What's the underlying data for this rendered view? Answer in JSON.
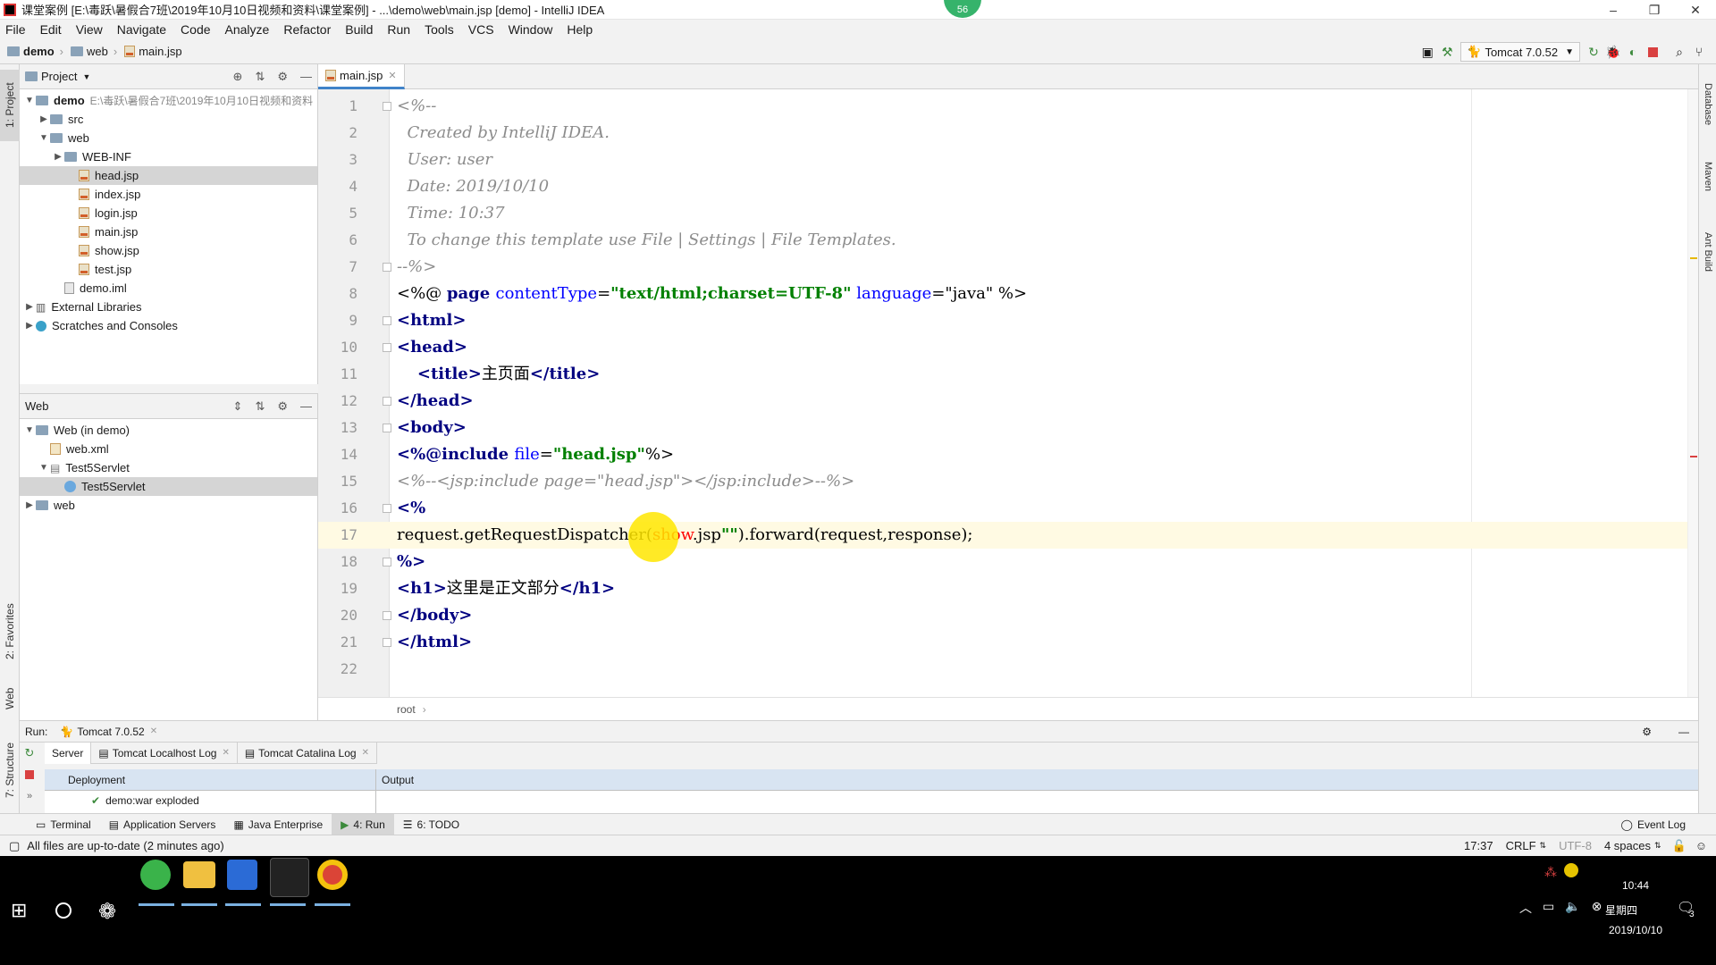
{
  "window": {
    "title": "课堂案例 [E:\\毒跃\\暑假合7班\\2019年10月10日视频和资料\\课堂案例] - ...\\demo\\web\\main.jsp [demo] - IntelliJ IDEA",
    "notification_badge": "56"
  },
  "menu": [
    "File",
    "Edit",
    "View",
    "Navigate",
    "Code",
    "Analyze",
    "Refactor",
    "Build",
    "Run",
    "Tools",
    "VCS",
    "Window",
    "Help"
  ],
  "nav": {
    "crumbs": [
      "demo",
      "web",
      "main.jsp"
    ],
    "run_config": "Tomcat 7.0.52"
  },
  "left_strip": {
    "project_tab": "1: Project",
    "favorites_tab": "2: Favorites",
    "web_tab": "Web",
    "structure_tab": "7: Structure"
  },
  "right_strip": [
    "Database",
    "Maven",
    "Ant Build"
  ],
  "project_panel": {
    "title": "Project",
    "tree": [
      {
        "label": "demo",
        "path": "E:\\毒跃\\暑假合7班\\2019年10月10日视频和资料",
        "indent": 0,
        "arrow": "down",
        "type": "module",
        "bold": true
      },
      {
        "label": "src",
        "indent": 1,
        "arrow": "right",
        "type": "folder"
      },
      {
        "label": "web",
        "indent": 1,
        "arrow": "down",
        "type": "folder"
      },
      {
        "label": "WEB-INF",
        "indent": 2,
        "arrow": "right",
        "type": "folder"
      },
      {
        "label": "head.jsp",
        "indent": 3,
        "arrow": "",
        "type": "jsp",
        "selected": true
      },
      {
        "label": "index.jsp",
        "indent": 3,
        "arrow": "",
        "type": "jsp"
      },
      {
        "label": "login.jsp",
        "indent": 3,
        "arrow": "",
        "type": "jsp"
      },
      {
        "label": "main.jsp",
        "indent": 3,
        "arrow": "",
        "type": "jsp"
      },
      {
        "label": "show.jsp",
        "indent": 3,
        "arrow": "",
        "type": "jsp"
      },
      {
        "label": "test.jsp",
        "indent": 3,
        "arrow": "",
        "type": "jsp"
      },
      {
        "label": "demo.iml",
        "indent": 2,
        "arrow": "",
        "type": "file"
      },
      {
        "label": "External Libraries",
        "indent": 0,
        "arrow": "right",
        "type": "lib"
      },
      {
        "label": "Scratches and Consoles",
        "indent": 0,
        "arrow": "right",
        "type": "scratch"
      }
    ]
  },
  "web_panel": {
    "title": "Web",
    "tree": [
      {
        "label": "Web (in demo)",
        "indent": 0,
        "arrow": "down",
        "type": "module"
      },
      {
        "label": "web.xml",
        "indent": 1,
        "arrow": "",
        "type": "xml"
      },
      {
        "label": "Test5Servlet",
        "indent": 1,
        "arrow": "down",
        "type": "servlet"
      },
      {
        "label": "Test5Servlet",
        "indent": 2,
        "arrow": "",
        "type": "class",
        "selected": true
      },
      {
        "label": "web",
        "indent": 0,
        "arrow": "right",
        "type": "folder"
      }
    ]
  },
  "editor": {
    "tab": "main.jsp",
    "breadcrumb": "root",
    "current_line": 17,
    "lines": [
      [
        [
          "cmt",
          "<%--"
        ]
      ],
      [
        [
          "cmt",
          "  Created by IntelliJ IDEA."
        ]
      ],
      [
        [
          "cmt",
          "  User: user"
        ]
      ],
      [
        [
          "cmt",
          "  Date: 2019/10/10"
        ]
      ],
      [
        [
          "cmt",
          "  Time: 10:37"
        ]
      ],
      [
        [
          "cmt",
          "  To change this template use File | Settings | File Templates."
        ]
      ],
      [
        [
          "cmt",
          "--%>"
        ]
      ],
      [
        [
          "plain",
          "<%@ "
        ],
        [
          "dir",
          "page "
        ],
        [
          "attr",
          "contentType"
        ],
        [
          "plain",
          "="
        ],
        [
          "str",
          "\"text/html;charset=UTF-8\""
        ],
        [
          "plain",
          " "
        ],
        [
          "attr",
          "language"
        ],
        [
          "plain",
          "=\""
        ],
        [
          "plain",
          "java"
        ],
        [
          "plain",
          "\" %>"
        ]
      ],
      [
        [
          "tag",
          "<html>"
        ]
      ],
      [
        [
          "tag",
          "<head>"
        ]
      ],
      [
        [
          "plain",
          "    "
        ],
        [
          "tag",
          "<title>"
        ],
        [
          "plain",
          "主页面"
        ],
        [
          "tag",
          "</title>"
        ]
      ],
      [
        [
          "tag",
          "</head>"
        ]
      ],
      [
        [
          "tag",
          "<body>"
        ]
      ],
      [
        [
          "dir",
          "<%@include "
        ],
        [
          "attr",
          "file"
        ],
        [
          "plain",
          "="
        ],
        [
          "str",
          "\"head.jsp\""
        ],
        [
          "plain",
          "%>"
        ]
      ],
      [
        [
          "cmt",
          "<%--<jsp:include page=\"head.jsp\"></jsp:include>--%>"
        ]
      ],
      [
        [
          "dir",
          "<%"
        ]
      ],
      [
        [
          "plain",
          "request.getRequestDispatcher("
        ],
        [
          "err",
          "show"
        ],
        [
          "plain",
          ".jsp"
        ],
        [
          "str",
          "\"\""
        ],
        [
          "plain",
          ").forward(request,response);"
        ]
      ],
      [
        [
          "dir",
          "%>"
        ]
      ],
      [
        [
          "tag",
          "<h1>"
        ],
        [
          "plain",
          "这里是正文部分"
        ],
        [
          "tag",
          "</h1>"
        ]
      ],
      [
        [
          "tag",
          "</body>"
        ]
      ],
      [
        [
          "tag",
          "</html>"
        ]
      ],
      [
        [
          "plain",
          ""
        ]
      ]
    ]
  },
  "run_panel": {
    "label": "Run:",
    "config": "Tomcat 7.0.52",
    "tabs": [
      "Server",
      "Tomcat Localhost Log",
      "Tomcat Catalina Log"
    ],
    "deployment_header": "Deployment",
    "output_header": "Output",
    "deployment_item": "demo:war exploded"
  },
  "tool_tabs": [
    "Terminal",
    "Application Servers",
    "Java Enterprise",
    "4: Run",
    "6: TODO"
  ],
  "event_log": "Event Log",
  "status": {
    "message": "All files are up-to-date (2 minutes ago)",
    "position": "17:37",
    "line_sep": "CRLF",
    "encoding": "UTF-8",
    "indent": "4 spaces"
  },
  "taskbar": {
    "time": "10:44",
    "weekday": "星期四",
    "date": "2019/10/10",
    "notification_count": "3"
  },
  "colors": {
    "accent": "#4083c9",
    "current_line": "#fffae3",
    "selection": "#d5d5d5"
  }
}
